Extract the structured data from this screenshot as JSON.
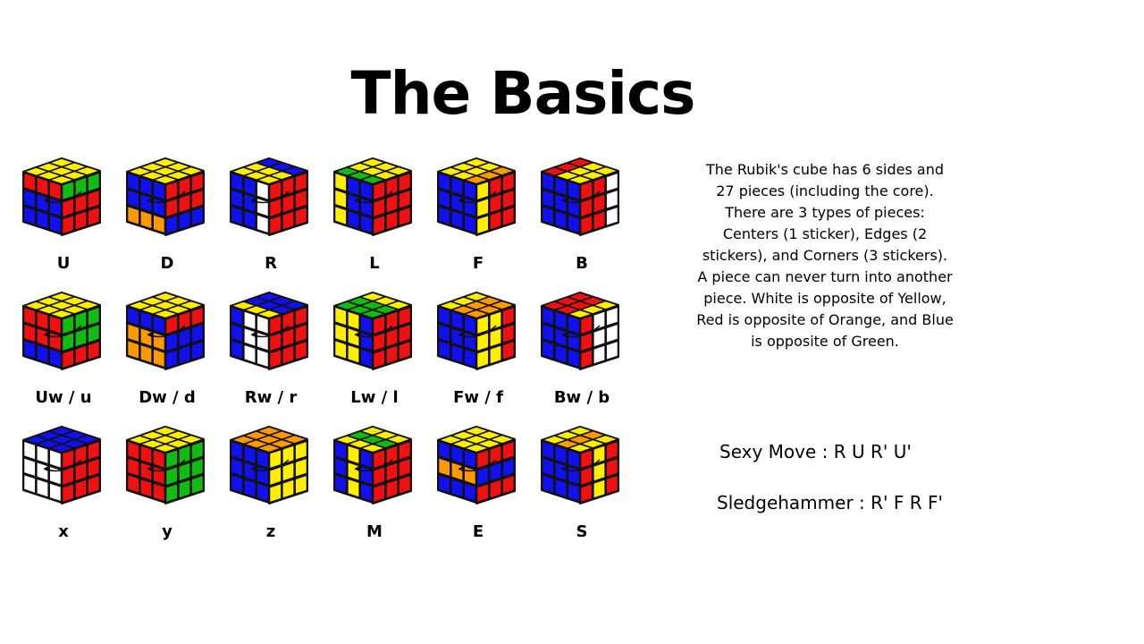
{
  "title": "The Basics",
  "description": "The Rubik's cube has 6 sides and 27 pieces (including the core). There are 3 types of pieces: Centers (1 sticker), Edges (2 stickers), and Corners (3 stickers). A piece can never turn into another piece. White is opposite of Yellow, Red is opposite of Orange, and Blue is opposite of Green.",
  "algorithms": [
    {
      "text": "Sexy Move : R U R' U'"
    },
    {
      "text": "Sledgehammer : R' F R F'"
    }
  ],
  "colors": {
    "W": "#ffffff",
    "Y": "#ffee00",
    "R": "#ee1111",
    "O": "#ff9900",
    "B": "#1111ee",
    "G": "#11bb11"
  },
  "cubes": [
    {
      "label": "U",
      "top": [
        "Y",
        "Y",
        "Y",
        "Y",
        "Y",
        "Y",
        "Y",
        "Y",
        "Y"
      ],
      "front": [
        "R",
        "R",
        "R",
        "B",
        "B",
        "B",
        "B",
        "B",
        "B"
      ],
      "right": [
        "G",
        "G",
        "G",
        "R",
        "R",
        "R",
        "R",
        "R",
        "R"
      ]
    },
    {
      "label": "D",
      "top": [
        "Y",
        "Y",
        "Y",
        "Y",
        "Y",
        "Y",
        "Y",
        "Y",
        "Y"
      ],
      "front": [
        "B",
        "B",
        "B",
        "B",
        "B",
        "B",
        "O",
        "O",
        "O"
      ],
      "right": [
        "R",
        "R",
        "R",
        "R",
        "R",
        "R",
        "B",
        "B",
        "B"
      ]
    },
    {
      "label": "R",
      "top": [
        "Y",
        "Y",
        "B",
        "Y",
        "Y",
        "B",
        "Y",
        "Y",
        "B"
      ],
      "front": [
        "B",
        "B",
        "W",
        "B",
        "B",
        "W",
        "B",
        "B",
        "W"
      ],
      "right": [
        "R",
        "R",
        "R",
        "R",
        "R",
        "R",
        "R",
        "R",
        "R"
      ]
    },
    {
      "label": "L",
      "top": [
        "G",
        "Y",
        "Y",
        "G",
        "Y",
        "Y",
        "G",
        "Y",
        "Y"
      ],
      "front": [
        "Y",
        "B",
        "B",
        "Y",
        "B",
        "B",
        "Y",
        "B",
        "B"
      ],
      "right": [
        "R",
        "R",
        "R",
        "R",
        "R",
        "R",
        "R",
        "R",
        "R"
      ]
    },
    {
      "label": "F",
      "top": [
        "Y",
        "Y",
        "Y",
        "Y",
        "Y",
        "Y",
        "O",
        "O",
        "O"
      ],
      "front": [
        "B",
        "B",
        "B",
        "B",
        "B",
        "B",
        "B",
        "B",
        "B"
      ],
      "right": [
        "Y",
        "R",
        "R",
        "Y",
        "R",
        "R",
        "Y",
        "R",
        "R"
      ]
    },
    {
      "label": "B",
      "top": [
        "R",
        "R",
        "R",
        "Y",
        "Y",
        "Y",
        "Y",
        "Y",
        "Y"
      ],
      "front": [
        "B",
        "B",
        "B",
        "B",
        "B",
        "B",
        "B",
        "B",
        "B"
      ],
      "right": [
        "R",
        "R",
        "W",
        "R",
        "R",
        "W",
        "R",
        "R",
        "W"
      ]
    },
    {
      "label": "Uw / u",
      "top": [
        "Y",
        "Y",
        "Y",
        "Y",
        "Y",
        "Y",
        "Y",
        "Y",
        "Y"
      ],
      "front": [
        "R",
        "R",
        "R",
        "R",
        "R",
        "R",
        "B",
        "B",
        "B"
      ],
      "right": [
        "G",
        "G",
        "G",
        "G",
        "G",
        "G",
        "R",
        "R",
        "R"
      ]
    },
    {
      "label": "Dw / d",
      "top": [
        "Y",
        "Y",
        "Y",
        "Y",
        "Y",
        "Y",
        "Y",
        "Y",
        "Y"
      ],
      "front": [
        "B",
        "B",
        "B",
        "O",
        "O",
        "O",
        "O",
        "O",
        "O"
      ],
      "right": [
        "R",
        "R",
        "R",
        "B",
        "B",
        "B",
        "B",
        "B",
        "B"
      ]
    },
    {
      "label": "Rw / r",
      "top": [
        "Y",
        "B",
        "B",
        "Y",
        "B",
        "B",
        "Y",
        "B",
        "B"
      ],
      "front": [
        "B",
        "W",
        "W",
        "B",
        "W",
        "W",
        "B",
        "W",
        "W"
      ],
      "right": [
        "R",
        "R",
        "R",
        "R",
        "R",
        "R",
        "R",
        "R",
        "R"
      ]
    },
    {
      "label": "Lw / l",
      "top": [
        "G",
        "G",
        "Y",
        "G",
        "G",
        "Y",
        "G",
        "G",
        "Y"
      ],
      "front": [
        "Y",
        "Y",
        "B",
        "Y",
        "Y",
        "B",
        "Y",
        "Y",
        "B"
      ],
      "right": [
        "R",
        "R",
        "R",
        "R",
        "R",
        "R",
        "R",
        "R",
        "R"
      ]
    },
    {
      "label": "Fw / f",
      "top": [
        "Y",
        "Y",
        "Y",
        "O",
        "O",
        "O",
        "O",
        "O",
        "O"
      ],
      "front": [
        "B",
        "B",
        "B",
        "B",
        "B",
        "B",
        "B",
        "B",
        "B"
      ],
      "right": [
        "Y",
        "Y",
        "R",
        "Y",
        "Y",
        "R",
        "Y",
        "Y",
        "R"
      ]
    },
    {
      "label": "Bw / b",
      "top": [
        "R",
        "R",
        "R",
        "R",
        "R",
        "R",
        "Y",
        "Y",
        "Y"
      ],
      "front": [
        "B",
        "B",
        "B",
        "B",
        "B",
        "B",
        "B",
        "B",
        "B"
      ],
      "right": [
        "R",
        "W",
        "W",
        "R",
        "W",
        "W",
        "R",
        "W",
        "W"
      ]
    },
    {
      "label": "x",
      "top": [
        "B",
        "B",
        "B",
        "B",
        "B",
        "B",
        "B",
        "B",
        "B"
      ],
      "front": [
        "W",
        "W",
        "W",
        "W",
        "W",
        "W",
        "W",
        "W",
        "W"
      ],
      "right": [
        "R",
        "R",
        "R",
        "R",
        "R",
        "R",
        "R",
        "R",
        "R"
      ]
    },
    {
      "label": "y",
      "top": [
        "Y",
        "Y",
        "Y",
        "Y",
        "Y",
        "Y",
        "Y",
        "Y",
        "Y"
      ],
      "front": [
        "R",
        "R",
        "R",
        "R",
        "R",
        "R",
        "R",
        "R",
        "R"
      ],
      "right": [
        "G",
        "G",
        "G",
        "G",
        "G",
        "G",
        "G",
        "G",
        "G"
      ]
    },
    {
      "label": "z",
      "top": [
        "O",
        "O",
        "O",
        "O",
        "O",
        "O",
        "O",
        "O",
        "O"
      ],
      "front": [
        "B",
        "B",
        "B",
        "B",
        "B",
        "B",
        "B",
        "B",
        "B"
      ],
      "right": [
        "Y",
        "Y",
        "Y",
        "Y",
        "Y",
        "Y",
        "Y",
        "Y",
        "Y"
      ]
    },
    {
      "label": "M",
      "top": [
        "Y",
        "G",
        "Y",
        "Y",
        "G",
        "Y",
        "Y",
        "G",
        "Y"
      ],
      "front": [
        "B",
        "Y",
        "B",
        "B",
        "Y",
        "B",
        "B",
        "Y",
        "B"
      ],
      "right": [
        "R",
        "R",
        "R",
        "R",
        "R",
        "R",
        "R",
        "R",
        "R"
      ]
    },
    {
      "label": "E",
      "top": [
        "Y",
        "Y",
        "Y",
        "Y",
        "Y",
        "Y",
        "Y",
        "Y",
        "Y"
      ],
      "front": [
        "B",
        "B",
        "B",
        "O",
        "O",
        "O",
        "B",
        "B",
        "B"
      ],
      "right": [
        "R",
        "R",
        "R",
        "B",
        "B",
        "B",
        "R",
        "R",
        "R"
      ]
    },
    {
      "label": "S",
      "top": [
        "Y",
        "Y",
        "Y",
        "O",
        "O",
        "O",
        "Y",
        "Y",
        "Y"
      ],
      "front": [
        "B",
        "B",
        "B",
        "B",
        "B",
        "B",
        "B",
        "B",
        "B"
      ],
      "right": [
        "R",
        "Y",
        "R",
        "R",
        "Y",
        "R",
        "R",
        "Y",
        "R"
      ]
    }
  ]
}
